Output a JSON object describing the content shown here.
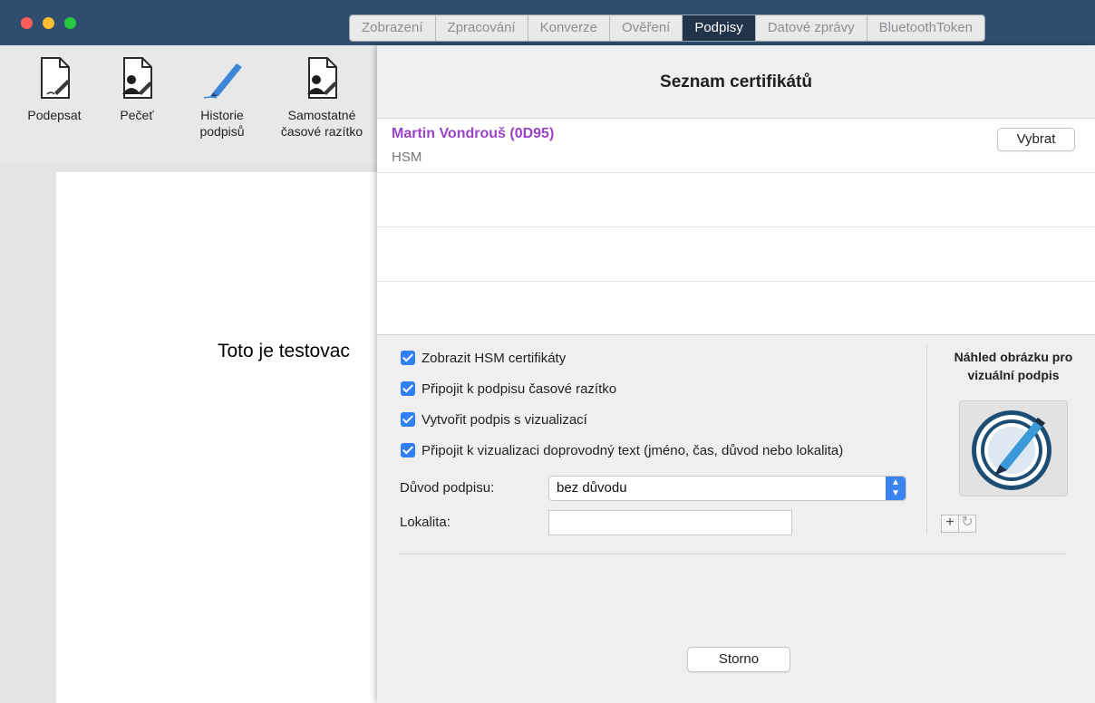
{
  "window": {
    "controls": {
      "close_color": "#ff5f57",
      "minimize_color": "#febc2e",
      "zoom_color": "#28c840"
    }
  },
  "tabs": [
    {
      "label": "Zobrazení",
      "active": false
    },
    {
      "label": "Zpracování",
      "active": false
    },
    {
      "label": "Konverze",
      "active": false
    },
    {
      "label": "Ověření",
      "active": false
    },
    {
      "label": "Podpisy",
      "active": true
    },
    {
      "label": "Datové zprávy",
      "active": false
    },
    {
      "label": "BluetoothToken",
      "active": false
    }
  ],
  "toolbar": {
    "sign": {
      "label": "Podepsat",
      "icon": "sign-document-icon"
    },
    "seal": {
      "label": "Pečeť",
      "icon": "seal-document-icon"
    },
    "history": {
      "line1": "Historie",
      "line2": "podpisů",
      "icon": "pen-icon"
    },
    "timestamp": {
      "line1": "Samostatné",
      "line2": "časové razítko",
      "icon": "timestamp-document-icon"
    }
  },
  "document": {
    "text": "Toto je testovac"
  },
  "panel": {
    "title": "Seznam certifikátů",
    "certificates": [
      {
        "name": "Martin Vondrouš (0D95)",
        "type": "HSM",
        "select_label": "Vybrat"
      }
    ],
    "options": [
      {
        "label": "Zobrazit HSM certifikáty",
        "checked": true
      },
      {
        "label": "Připojit k podpisu časové razítko",
        "checked": true
      },
      {
        "label": "Vytvořit podpis s vizualizací",
        "checked": true
      },
      {
        "label": "Připojit k vizualizaci doprovodný text (jméno, čas, důvod nebo lokalita)",
        "checked": true
      }
    ],
    "reason": {
      "label": "Důvod podpisu:",
      "value": "bez důvodu"
    },
    "location": {
      "label": "Lokalita:",
      "value": ""
    },
    "preview": {
      "title_line1": "Náhled obrázku pro",
      "title_line2": "vizuální podpis"
    },
    "cancel_label": "Storno",
    "accent_color": "#9a43c8",
    "checkbox_color": "#2f80f6"
  }
}
